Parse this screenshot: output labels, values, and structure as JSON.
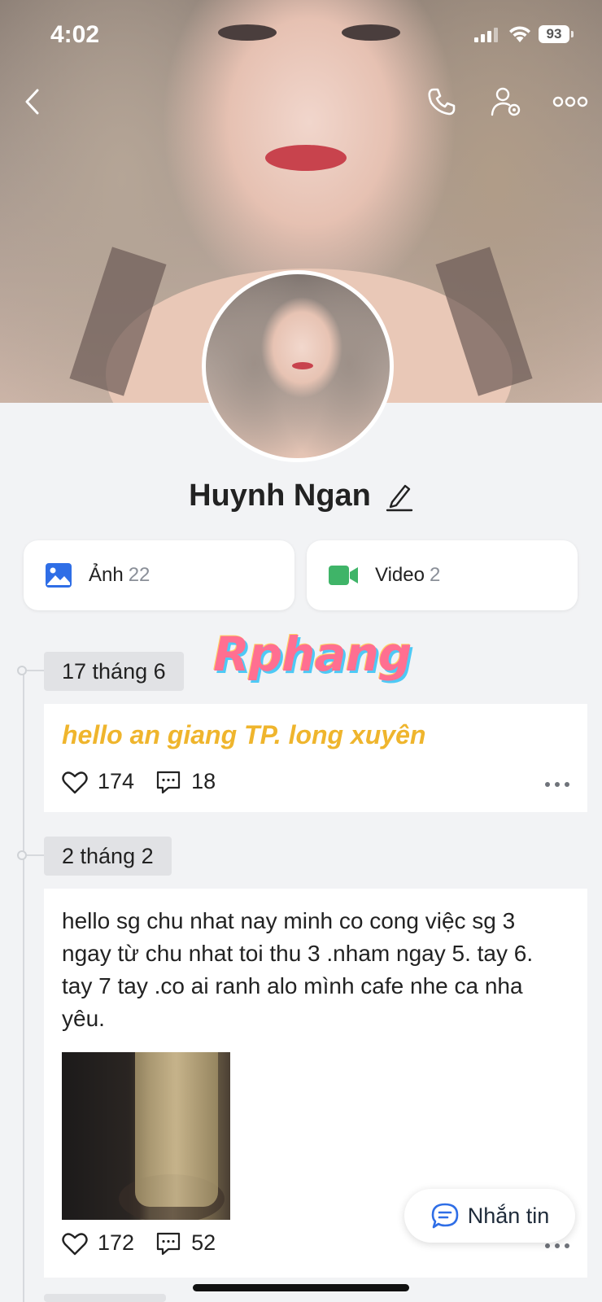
{
  "status_bar": {
    "time": "4:02",
    "battery": "93"
  },
  "profile": {
    "name": "Huynh Ngan"
  },
  "media_cards": [
    {
      "label": "Ảnh",
      "count": "22"
    },
    {
      "label": "Video",
      "count": "2"
    }
  ],
  "watermark": "Rphang",
  "posts": [
    {
      "date": "17 tháng 6",
      "text": "hello an giang TP. long xuyên",
      "likes": "174",
      "comments": "18"
    },
    {
      "date": "2 tháng 2",
      "text": "hello sg chu nhat nay minh co cong việc sg 3 ngay từ chu nhat toi thu 3 .nham ngay 5. tay 6. tay 7 tay .co ai ranh alo mình cafe  nhe ca nha yêu.",
      "likes": "172",
      "comments": "52"
    }
  ],
  "message_button": {
    "label": "Nhắn tin"
  },
  "colors": {
    "accent_blue": "#2f6ee6",
    "video_green": "#3fb468",
    "post_yellow": "#efb52d"
  }
}
